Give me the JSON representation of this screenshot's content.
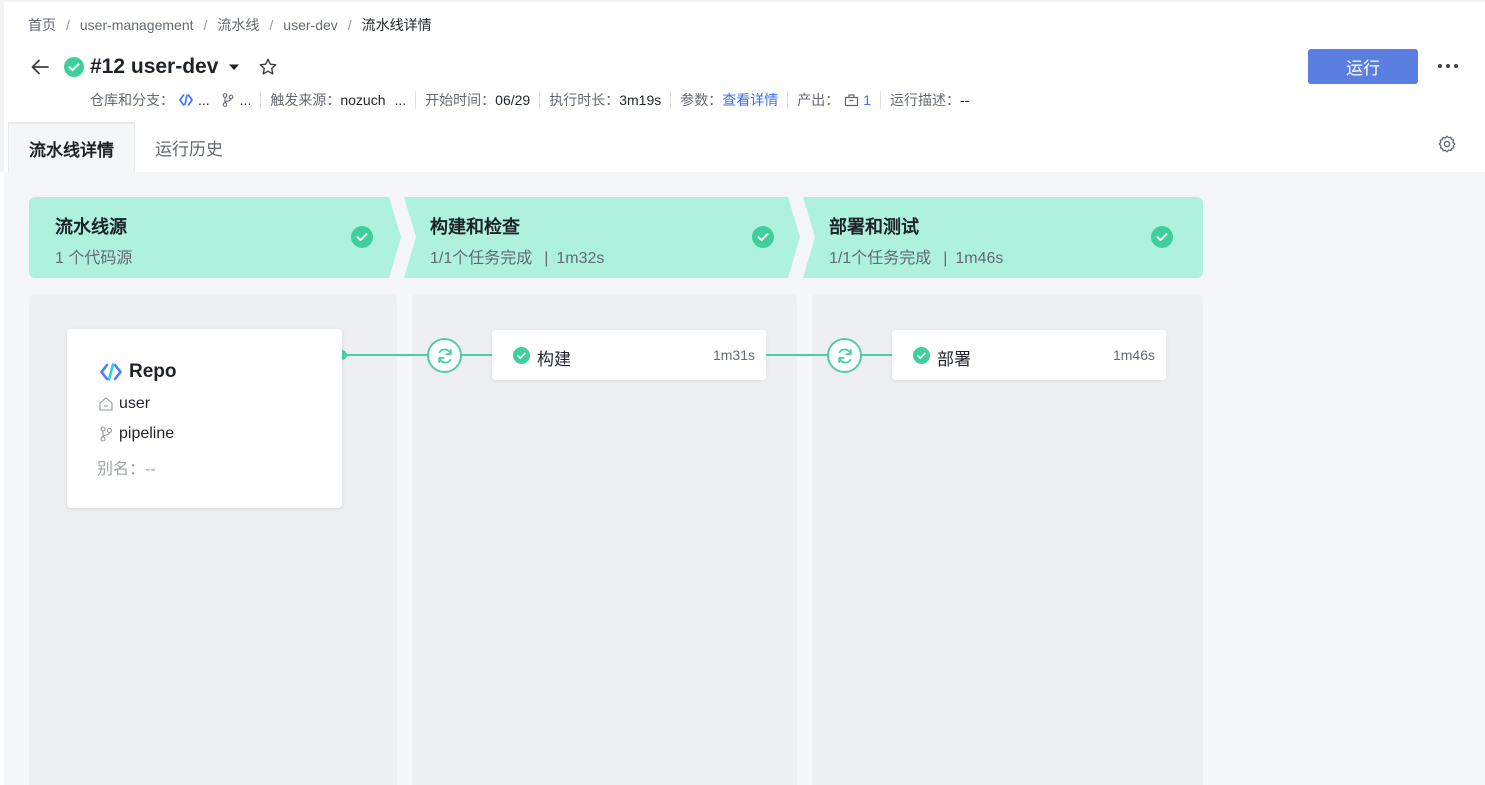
{
  "breadcrumb": {
    "items": [
      "首页",
      "user-management",
      "流水线",
      "user-dev"
    ],
    "current": "流水线详情",
    "separator": "/"
  },
  "header": {
    "run_title": "#12 user-dev",
    "run_button": "运行",
    "status_color": "#3fcf9a",
    "accent_color": "#5b7fe0"
  },
  "meta": {
    "repo_label": "仓库和分支：",
    "repo_value": "...",
    "branch_value": "...",
    "trigger_label": "触发来源：",
    "trigger_value": "nozuch",
    "trigger_more": "...",
    "start_label": "开始时间：",
    "start_value": "06/29",
    "duration_label": "执行时长：",
    "duration_value": "3m19s",
    "params_label": "参数：",
    "params_link": "查看详情",
    "output_label": "产出：",
    "output_count": "1",
    "desc_label": "运行描述：",
    "desc_value": "--"
  },
  "tabs": [
    {
      "label": "流水线详情",
      "active": true
    },
    {
      "label": "运行历史",
      "active": false
    }
  ],
  "stages": [
    {
      "name": "流水线源",
      "summary": "1 个代码源"
    },
    {
      "name": "构建和检查",
      "summary": "1/1个任务完成",
      "duration": "1m32s"
    },
    {
      "name": "部署和测试",
      "summary": "1/1个任务完成",
      "duration": "1m46s"
    }
  ],
  "source_card": {
    "title": "Repo",
    "repo": "user",
    "branch": "pipeline",
    "alias": "别名：--"
  },
  "jobs": [
    {
      "name": "构建",
      "time": "1m31s"
    },
    {
      "name": "部署",
      "time": "1m46s"
    }
  ],
  "icons": {
    "back": "arrow-left-icon",
    "status": "check-circle-icon",
    "dropdown": "caret-down-icon",
    "favorite": "star-icon",
    "more": "more-icon",
    "settings": "gear-icon",
    "repo": "repo-logo-icon",
    "trigger": "refresh-icon"
  }
}
